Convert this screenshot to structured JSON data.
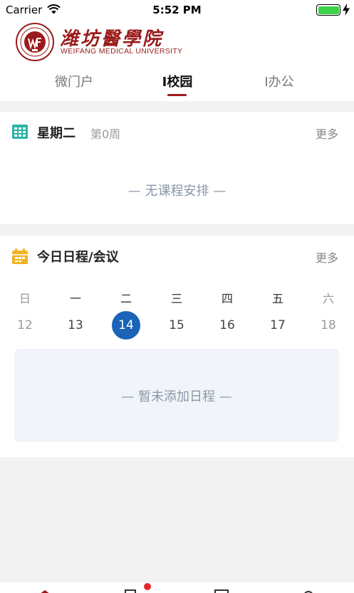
{
  "status_bar": {
    "carrier": "Carrier",
    "time": "5:52 PM"
  },
  "brand": {
    "name_cn": "潍坊醫學院",
    "name_en": "WEIFANG MEDICAL UNIVERSITY"
  },
  "tabs": [
    {
      "label": "微门户"
    },
    {
      "label": "I校园"
    },
    {
      "label": "I办公"
    }
  ],
  "active_tab": "I校园",
  "course_card": {
    "title": "星期二",
    "week": "第0周",
    "more": "更多",
    "empty_text": "— 无课程安排 —"
  },
  "schedule_card": {
    "title": "今日日程/会议",
    "more": "更多",
    "weekdays": [
      "日",
      "一",
      "二",
      "三",
      "四",
      "五",
      "六"
    ],
    "days": [
      "12",
      "13",
      "14",
      "15",
      "16",
      "17",
      "18"
    ],
    "today": "14",
    "empty_text": "— 暂未添加日程 —"
  },
  "colors": {
    "brand": "#9a1b1b",
    "accent": "#1b63b6",
    "badge": "#e3242b",
    "battery": "#3dd14a"
  }
}
